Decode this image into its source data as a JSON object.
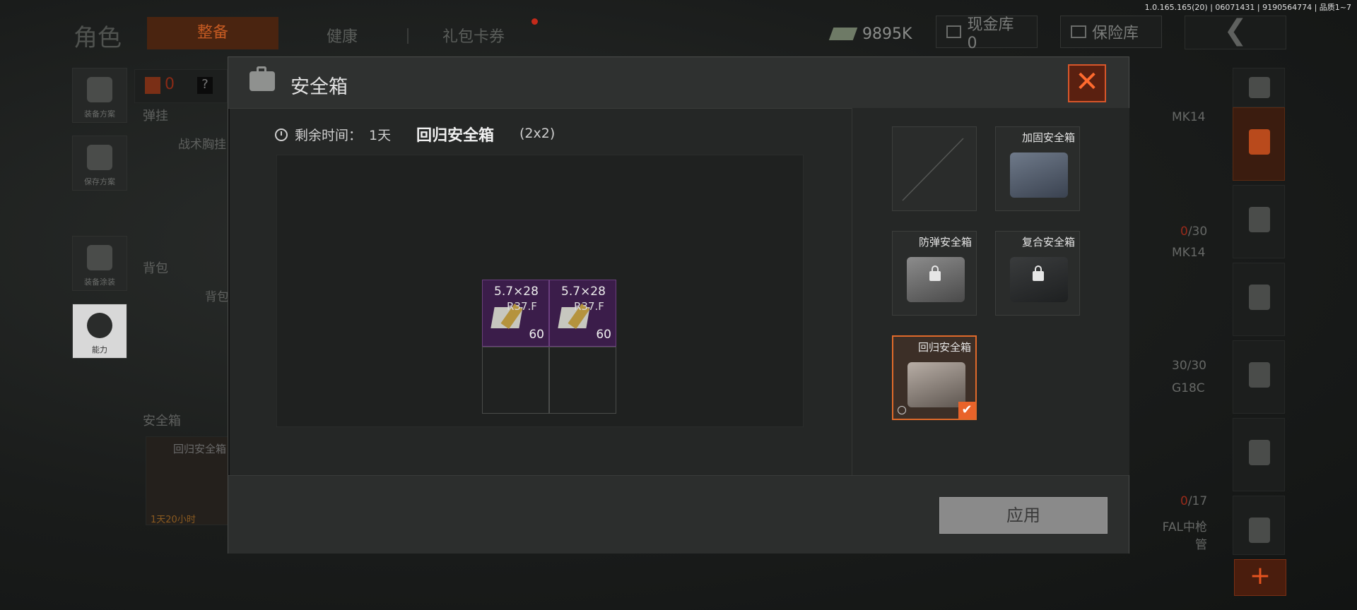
{
  "version": "1.0.165.165(20) | 06071431 | 9190564774 | 品质1~7",
  "background": {
    "page_title": "角色",
    "tabs": [
      {
        "label": "整备",
        "active": true
      },
      {
        "label": "健康",
        "active": false
      },
      {
        "label": "礼包卡券",
        "active": false
      }
    ],
    "money": "9895K",
    "cash_vault": "现金库 0",
    "safe_vault": "保险库",
    "back_icon": "chevron-left-icon",
    "left_nav": [
      {
        "label": "装备方案"
      },
      {
        "label": "保存方案"
      },
      {
        "label": "装备涂装"
      },
      {
        "label": "能力"
      }
    ],
    "vest_count": "0",
    "help": "?",
    "sections": {
      "chest_rig": "弹挂",
      "chest_rig_item": "战术胸挂",
      "backpack": "背包",
      "backpack_item": "背包",
      "safe_box": "安全箱",
      "safe_box_item": "回归安全箱",
      "safe_box_timer": "1天20小时"
    },
    "weapons": [
      {
        "name": "MK14",
        "ammo_current": "0",
        "ammo_total": "/30"
      },
      {
        "name": "MK14",
        "ammo_current": "30",
        "ammo_total": "/30"
      },
      {
        "name": "G18C",
        "ammo_current": "0",
        "ammo_total": "/17"
      },
      {
        "name": "FAL中枪管",
        "ammo_current": "",
        "ammo_total": ""
      }
    ],
    "plus": "+"
  },
  "modal": {
    "title": "安全箱",
    "close_icon": "close-icon",
    "remaining_time_label": "剩余时间：",
    "remaining_time_value": "1天",
    "case_name": "回归安全箱",
    "case_size": "(2x2)",
    "grid_items": [
      {
        "caliber": "5.7×28",
        "code": "R37.F",
        "count": "60"
      },
      {
        "caliber": "5.7×28",
        "code": "R37.F",
        "count": "60"
      }
    ],
    "cases": [
      {
        "name": "",
        "state": "empty"
      },
      {
        "name": "加固安全箱",
        "state": "available"
      },
      {
        "name": "防弹安全箱",
        "state": "locked"
      },
      {
        "name": "复合安全箱",
        "state": "locked"
      },
      {
        "name": "回归安全箱",
        "state": "selected"
      }
    ],
    "apply_label": "应用"
  },
  "colors": {
    "accent": "#e9632a",
    "ammo_cell": "#3b1d4a",
    "apply_disabled": "#8a8a8a"
  }
}
